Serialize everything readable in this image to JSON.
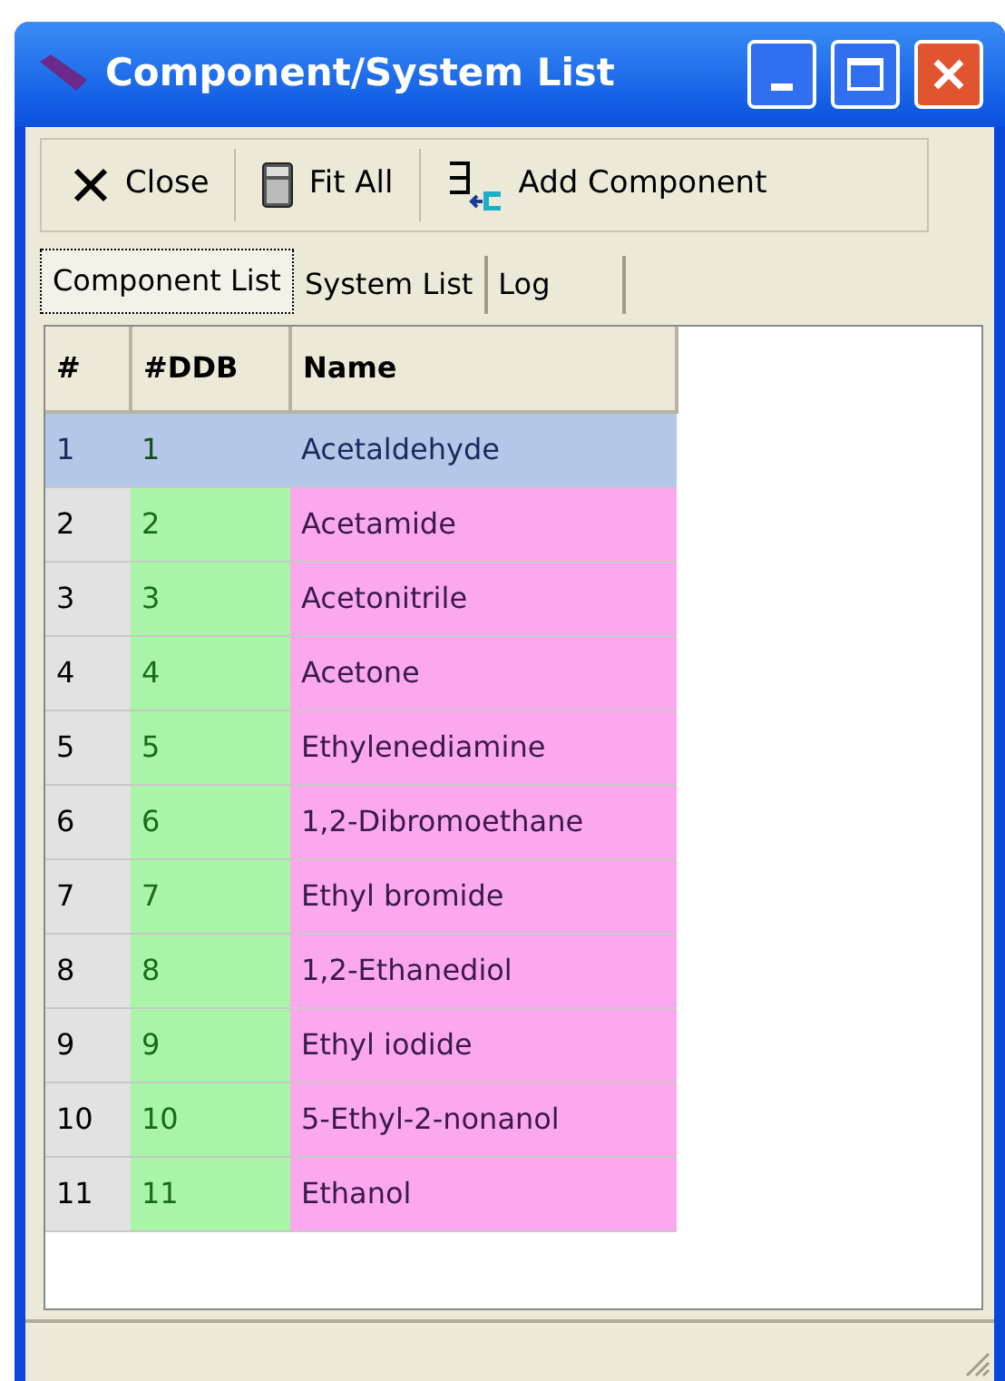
{
  "window": {
    "title": "Component/System List"
  },
  "toolbar": [
    {
      "kind": "close",
      "label": "Close"
    },
    {
      "kind": "calculator",
      "label": "Fit All"
    },
    {
      "kind": "add",
      "label": "Add Component"
    }
  ],
  "tabs": [
    {
      "label": "Component List",
      "selected": true
    },
    {
      "label": "System List",
      "selected": false
    },
    {
      "label": "Log",
      "selected": false
    }
  ],
  "table": {
    "columns": [
      "#",
      "#DDB",
      "Name"
    ],
    "rows": [
      {
        "cells": [
          "1",
          "1",
          "Acetaldehyde"
        ],
        "selected": true
      },
      {
        "cells": [
          "2",
          "2",
          "Acetamide"
        ],
        "selected": false
      },
      {
        "cells": [
          "3",
          "3",
          "Acetonitrile"
        ],
        "selected": false
      },
      {
        "cells": [
          "4",
          "4",
          "Acetone"
        ],
        "selected": false
      },
      {
        "cells": [
          "5",
          "5",
          "Ethylenediamine"
        ],
        "selected": false
      },
      {
        "cells": [
          "6",
          "6",
          "1,2-Dibromoethane"
        ],
        "selected": false
      },
      {
        "cells": [
          "7",
          "7",
          "Ethyl bromide"
        ],
        "selected": false
      },
      {
        "cells": [
          "8",
          "8",
          "1,2-Ethanediol"
        ],
        "selected": false
      },
      {
        "cells": [
          "9",
          "9",
          "Ethyl iodide"
        ],
        "selected": false
      },
      {
        "cells": [
          "10",
          "10",
          "5-Ethyl-2-nonanol"
        ],
        "selected": false
      },
      {
        "cells": [
          "11",
          "11",
          "Ethanol"
        ],
        "selected": false
      }
    ]
  }
}
